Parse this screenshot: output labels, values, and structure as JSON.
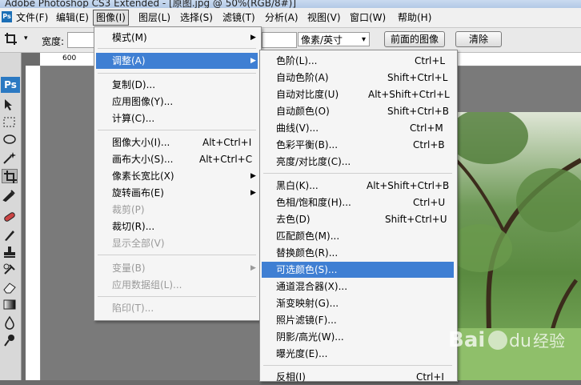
{
  "title": "Adobe Photoshop CS3 Extended - [原图.jpg @ 50%(RGB/8#)]",
  "menubar": {
    "items": [
      "文件(F)",
      "编辑(E)",
      "图像(I)",
      "图层(L)",
      "选择(S)",
      "滤镜(T)",
      "分析(A)",
      "视图(V)",
      "窗口(W)",
      "帮助(H)"
    ],
    "active": "图像(I)"
  },
  "options": {
    "width_label": "宽度:",
    "unit_select": "像素/英寸",
    "front_image_button": "前面的图像",
    "clear_button": "清除"
  },
  "ruler": {
    "label_600": "600"
  },
  "image_menu": {
    "items": [
      {
        "label": "模式(M)",
        "submenu": true
      },
      {
        "label": "调整(A)",
        "submenu": true,
        "highlighted": true
      },
      {
        "label": "复制(D)..."
      },
      {
        "label": "应用图像(Y)..."
      },
      {
        "label": "计算(C)..."
      },
      {
        "label": "图像大小(I)...",
        "shortcut": "Alt+Ctrl+I"
      },
      {
        "label": "画布大小(S)...",
        "shortcut": "Alt+Ctrl+C"
      },
      {
        "label": "像素长宽比(X)",
        "submenu": true
      },
      {
        "label": "旋转画布(E)",
        "submenu": true
      },
      {
        "label": "裁剪(P)",
        "disabled": true
      },
      {
        "label": "裁切(R)..."
      },
      {
        "label": "显示全部(V)",
        "disabled": true
      },
      {
        "label": "变量(B)",
        "submenu": true,
        "disabled": true
      },
      {
        "label": "应用数据组(L)...",
        "disabled": true
      },
      {
        "label": "陷印(T)...",
        "disabled": true
      }
    ]
  },
  "adjust_menu": {
    "items": [
      {
        "label": "色阶(L)...",
        "shortcut": "Ctrl+L"
      },
      {
        "label": "自动色阶(A)",
        "shortcut": "Shift+Ctrl+L"
      },
      {
        "label": "自动对比度(U)",
        "shortcut": "Alt+Shift+Ctrl+L"
      },
      {
        "label": "自动颜色(O)",
        "shortcut": "Shift+Ctrl+B"
      },
      {
        "label": "曲线(V)...",
        "shortcut": "Ctrl+M"
      },
      {
        "label": "色彩平衡(B)...",
        "shortcut": "Ctrl+B"
      },
      {
        "label": "亮度/对比度(C)..."
      },
      {
        "label": "黑白(K)...",
        "shortcut": "Alt+Shift+Ctrl+B"
      },
      {
        "label": "色相/饱和度(H)...",
        "shortcut": "Ctrl+U"
      },
      {
        "label": "去色(D)",
        "shortcut": "Shift+Ctrl+U"
      },
      {
        "label": "匹配颜色(M)..."
      },
      {
        "label": "替换颜色(R)..."
      },
      {
        "label": "可选颜色(S)...",
        "highlighted": true
      },
      {
        "label": "通道混合器(X)..."
      },
      {
        "label": "渐变映射(G)..."
      },
      {
        "label": "照片滤镜(F)..."
      },
      {
        "label": "阴影/高光(W)..."
      },
      {
        "label": "曝光度(E)..."
      },
      {
        "label": "反相(I)",
        "shortcut": "Ctrl+I"
      }
    ]
  },
  "colors": {
    "highlight": "#3f7fd3",
    "menu_bg": "#f5f5f5",
    "disabled": "#9a9a9a"
  }
}
